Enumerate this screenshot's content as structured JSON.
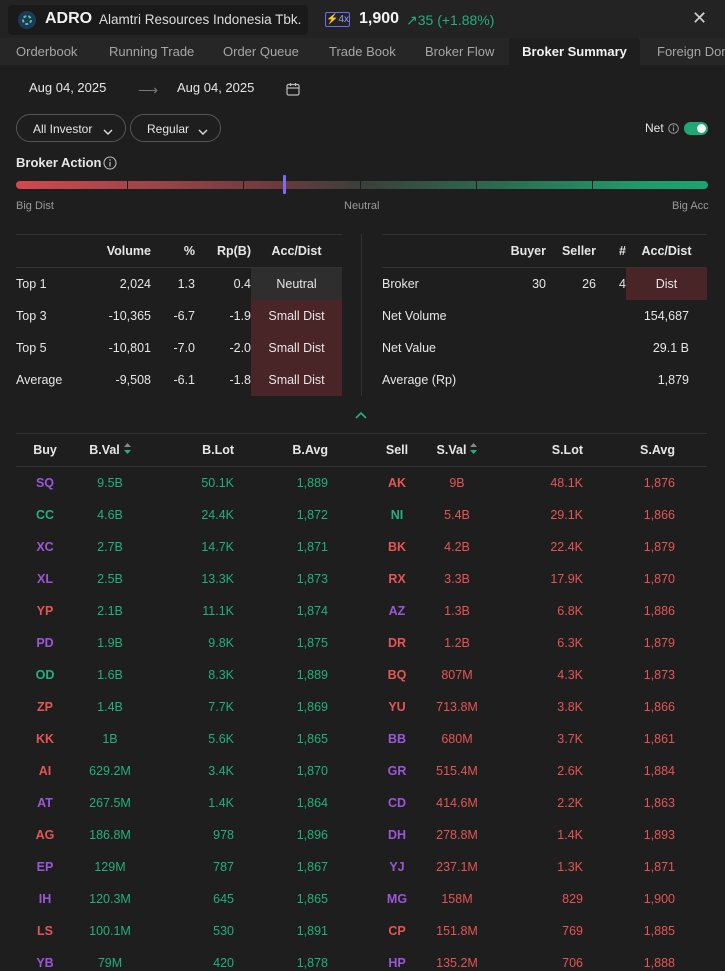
{
  "header": {
    "ticker": "ADRO",
    "company": "Alamtri Resources Indonesia Tbk.",
    "badge": "4x",
    "price": "1,900",
    "change": "35 (+1.88%)"
  },
  "tabs": [
    "Orderbook",
    "Running Trade",
    "Order Queue",
    "Trade Book",
    "Broker Flow",
    "Broker Summary",
    "Foreign Dom"
  ],
  "active_tab": "Broker Summary",
  "filters": {
    "start_date": "Aug 04, 2025",
    "end_date": "Aug 04, 2025",
    "investor": "All Investor",
    "market": "Regular",
    "net_label": "Net",
    "net_enabled": true
  },
  "broker_action": {
    "title": "Broker Action",
    "labels": {
      "left": "Big Dist",
      "center": "Neutral",
      "right": "Big Acc"
    },
    "level_fraction": 0.387,
    "colors": {
      "dist": "#d4474f",
      "acc": "#19a572",
      "marker": "#7b6cf0"
    }
  },
  "summary_left": {
    "headers": [
      "",
      "Volume",
      "%",
      "Rp(B)",
      "Acc/Dist"
    ],
    "rows": [
      {
        "label": "Top 1",
        "volume": "2,024",
        "pct": "1.3",
        "rpb": "0.4",
        "acc": "Neutral",
        "tone": "neutral"
      },
      {
        "label": "Top 3",
        "volume": "-10,365",
        "pct": "-6.7",
        "rpb": "-1.9",
        "acc": "Small Dist",
        "tone": "dist"
      },
      {
        "label": "Top 5",
        "volume": "-10,801",
        "pct": "-7.0",
        "rpb": "-2.0",
        "acc": "Small Dist",
        "tone": "dist"
      },
      {
        "label": "Average",
        "volume": "-9,508",
        "pct": "-6.1",
        "rpb": "-1.8",
        "acc": "Small Dist",
        "tone": "dist"
      }
    ]
  },
  "summary_right": {
    "headers": [
      "",
      "Buyer",
      "Seller",
      "#",
      "Acc/Dist"
    ],
    "broker_row": {
      "label": "Broker",
      "buyer": "30",
      "seller": "26",
      "count": "4",
      "acc": "Dist"
    },
    "rows": [
      {
        "label": "Net Volume",
        "value": "154,687"
      },
      {
        "label": "Net Value",
        "value": "29.1 B"
      },
      {
        "label": "Average (Rp)",
        "value": "1,879"
      }
    ]
  },
  "broker_table": {
    "headers": [
      "Buy",
      "B.Val",
      "B.Lot",
      "B.Avg",
      "Sell",
      "S.Val",
      "S.Lot",
      "S.Avg"
    ],
    "rows": [
      {
        "buy": "SQ",
        "bc": "p",
        "bval": "9.5B",
        "blot": "50.1K",
        "bavg": "1,889",
        "sell": "AK",
        "sc": "r",
        "sval": "9B",
        "slot": "48.1K",
        "savg": "1,876"
      },
      {
        "buy": "CC",
        "bc": "g",
        "bval": "4.6B",
        "blot": "24.4K",
        "bavg": "1,872",
        "sell": "NI",
        "sc": "g",
        "sval": "5.4B",
        "slot": "29.1K",
        "savg": "1,866"
      },
      {
        "buy": "XC",
        "bc": "p",
        "bval": "2.7B",
        "blot": "14.7K",
        "bavg": "1,871",
        "sell": "BK",
        "sc": "r",
        "sval": "4.2B",
        "slot": "22.4K",
        "savg": "1,879"
      },
      {
        "buy": "XL",
        "bc": "p",
        "bval": "2.5B",
        "blot": "13.3K",
        "bavg": "1,873",
        "sell": "RX",
        "sc": "r",
        "sval": "3.3B",
        "slot": "17.9K",
        "savg": "1,870"
      },
      {
        "buy": "YP",
        "bc": "r",
        "bval": "2.1B",
        "blot": "11.1K",
        "bavg": "1,874",
        "sell": "AZ",
        "sc": "p",
        "sval": "1.3B",
        "slot": "6.8K",
        "savg": "1,886"
      },
      {
        "buy": "PD",
        "bc": "p",
        "bval": "1.9B",
        "blot": "9.8K",
        "bavg": "1,875",
        "sell": "DR",
        "sc": "r",
        "sval": "1.2B",
        "slot": "6.3K",
        "savg": "1,879"
      },
      {
        "buy": "OD",
        "bc": "g",
        "bval": "1.6B",
        "blot": "8.3K",
        "bavg": "1,889",
        "sell": "BQ",
        "sc": "r",
        "sval": "807M",
        "slot": "4.3K",
        "savg": "1,873"
      },
      {
        "buy": "ZP",
        "bc": "r",
        "bval": "1.4B",
        "blot": "7.7K",
        "bavg": "1,869",
        "sell": "YU",
        "sc": "r",
        "sval": "713.8M",
        "slot": "3.8K",
        "savg": "1,866"
      },
      {
        "buy": "KK",
        "bc": "r",
        "bval": "1B",
        "blot": "5.6K",
        "bavg": "1,865",
        "sell": "BB",
        "sc": "p",
        "sval": "680M",
        "slot": "3.7K",
        "savg": "1,861"
      },
      {
        "buy": "AI",
        "bc": "r",
        "bval": "629.2M",
        "blot": "3.4K",
        "bavg": "1,870",
        "sell": "GR",
        "sc": "p",
        "sval": "515.4M",
        "slot": "2.6K",
        "savg": "1,884"
      },
      {
        "buy": "AT",
        "bc": "p",
        "bval": "267.5M",
        "blot": "1.4K",
        "bavg": "1,864",
        "sell": "CD",
        "sc": "p",
        "sval": "414.6M",
        "slot": "2.2K",
        "savg": "1,863"
      },
      {
        "buy": "AG",
        "bc": "r",
        "bval": "186.8M",
        "blot": "978",
        "bavg": "1,896",
        "sell": "DH",
        "sc": "p",
        "sval": "278.8M",
        "slot": "1.4K",
        "savg": "1,893"
      },
      {
        "buy": "EP",
        "bc": "p",
        "bval": "129M",
        "blot": "787",
        "bavg": "1,867",
        "sell": "YJ",
        "sc": "p",
        "sval": "237.1M",
        "slot": "1.3K",
        "savg": "1,871"
      },
      {
        "buy": "IH",
        "bc": "p",
        "bval": "120.3M",
        "blot": "645",
        "bavg": "1,865",
        "sell": "MG",
        "sc": "p",
        "sval": "158M",
        "slot": "829",
        "savg": "1,900"
      },
      {
        "buy": "LS",
        "bc": "r",
        "bval": "100.1M",
        "blot": "530",
        "bavg": "1,891",
        "sell": "CP",
        "sc": "r",
        "sval": "151.8M",
        "slot": "769",
        "savg": "1,885"
      },
      {
        "buy": "YB",
        "bc": "p",
        "bval": "79M",
        "blot": "420",
        "bavg": "1,878",
        "sell": "HP",
        "sc": "p",
        "sval": "135.2M",
        "slot": "706",
        "savg": "1,888"
      }
    ]
  }
}
